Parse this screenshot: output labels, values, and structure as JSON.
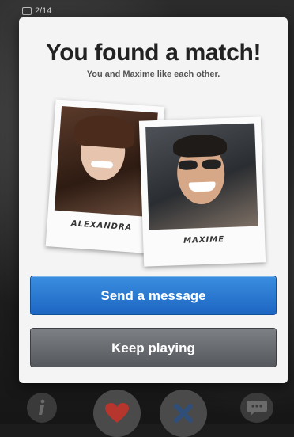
{
  "status": {
    "counter": "2/14"
  },
  "dialog": {
    "title": "You found a match!",
    "subtitle": "You and Maxime like each other."
  },
  "profiles": [
    {
      "name": "Alexandra"
    },
    {
      "name": "Maxime"
    }
  ],
  "actions": {
    "send_label": "Send a message",
    "keep_label": "Keep playing"
  },
  "colors": {
    "send_button": "#1d66c2",
    "keep_button": "#55585c",
    "heart": "#c8372d",
    "dismiss": "#2f4f7a"
  },
  "icons": {
    "info": "info-icon",
    "like": "heart-icon",
    "dismiss": "x-icon",
    "chat": "chat-bubble-icon"
  }
}
